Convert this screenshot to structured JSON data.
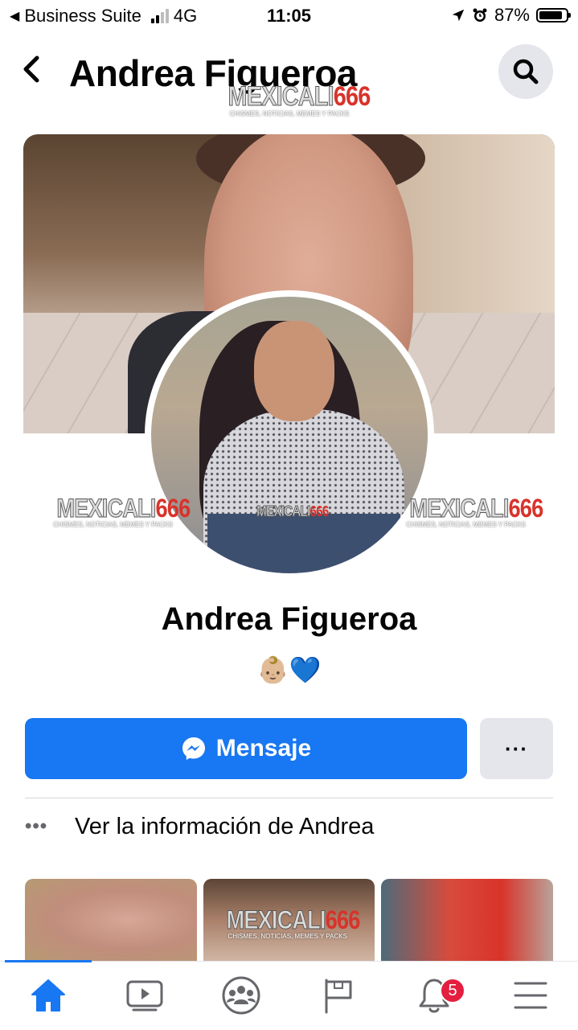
{
  "status_bar": {
    "back_app": "Business Suite",
    "network": "4G",
    "time": "11:05",
    "battery": "87%",
    "battery_level": 0.87
  },
  "header": {
    "title": "Andrea Figueroa"
  },
  "watermark": {
    "brand_part1": "MEXICALI",
    "brand_part2": "666",
    "tagline": "CHISMES, NOTICIAS, MEMES Y PACKS"
  },
  "profile": {
    "name": "Andrea Figueroa",
    "bio": "👶🏼💙"
  },
  "actions": {
    "message_label": "Mensaje",
    "more_label": "···"
  },
  "info_row": {
    "label": "Ver la información de Andrea"
  },
  "tab_bar": {
    "notifications_badge": "5",
    "accent": "#1877f2"
  },
  "colors": {
    "primary": "#1877f2",
    "badge": "#e41e3f"
  }
}
